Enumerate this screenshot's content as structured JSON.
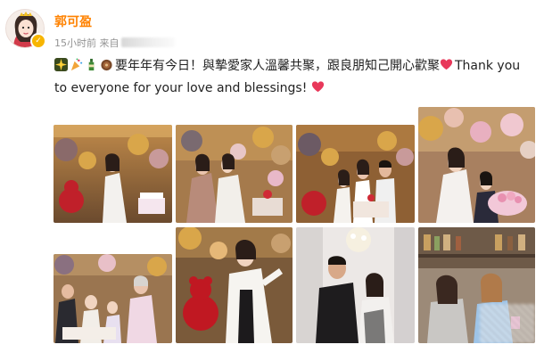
{
  "post": {
    "username": "郭可盈",
    "time_text": "15小时前 来自",
    "verified_badge": "✓",
    "text_main": "要年年有今日！與摯愛家人溫馨共聚，跟良朋知己開心歡聚",
    "text_english": "Thank you to everyone for your love and blessings!",
    "emojis": [
      "sparkle-emoji",
      "party-emoji",
      "bottle-emoji",
      "cake-emoji",
      "heart-emoji",
      "heart-emoji"
    ]
  },
  "colors": {
    "username": "#ff8200",
    "meta": "#939393",
    "heart": "#e8385a"
  },
  "photos": [
    {
      "id": "photo-1",
      "subject": "woman in white suit with red teddy bear and balloons"
    },
    {
      "id": "photo-2",
      "subject": "two women hugging beside birthday cake"
    },
    {
      "id": "photo-3",
      "subject": "family posing behind birthday cake with balloons"
    },
    {
      "id": "photo-4",
      "subject": "woman and girl with pink flower cake"
    },
    {
      "id": "photo-5",
      "subject": "group cutting birthday cake"
    },
    {
      "id": "photo-6",
      "subject": "woman in white blazer with red rose bear"
    },
    {
      "id": "photo-7",
      "subject": "couple posing under chandelier"
    },
    {
      "id": "photo-8",
      "subject": "two women smiling in a restaurant"
    }
  ]
}
